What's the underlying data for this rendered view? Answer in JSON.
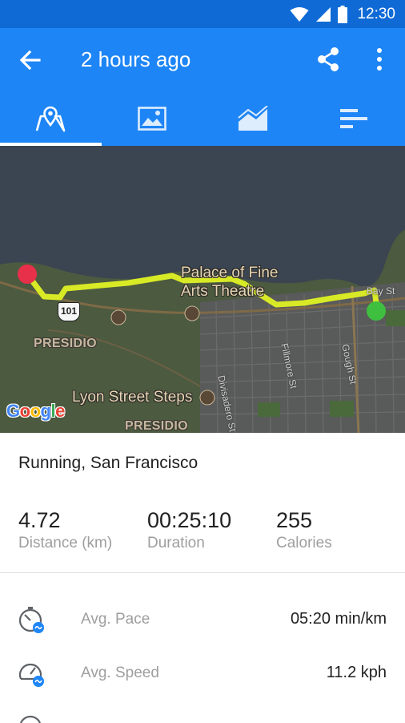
{
  "status_bar": {
    "time": "12:30"
  },
  "app_bar": {
    "title": "2 hours ago",
    "tabs": [
      {
        "id": "map",
        "icon": "map-pin-icon",
        "selected": true
      },
      {
        "id": "photos",
        "icon": "image-icon",
        "selected": false
      },
      {
        "id": "charts",
        "icon": "area-chart-icon",
        "selected": false
      },
      {
        "id": "splits",
        "icon": "bar-list-icon",
        "selected": false
      }
    ]
  },
  "map": {
    "labels": {
      "palace_line1": "Palace of Fine",
      "palace_line2": "Arts Theatre",
      "bay_st": "Bay St",
      "highway": "101",
      "presidio_1": "PRESIDIO",
      "presidio_2": "PRESIDIO",
      "lyon_steps": "Lyon Street Steps",
      "divisadero": "Divisadero St",
      "fillmore": "Fillmore St",
      "gough": "Gough St",
      "google": "Google"
    },
    "colors": {
      "water": "#3b4451",
      "land": "#4c5a40",
      "route": "#d8ea26",
      "start_marker": "#3fbf3f",
      "end_marker": "#e8304a"
    }
  },
  "activity": {
    "title": "Running, San Francisco",
    "stats": [
      {
        "value": "4.72",
        "label": "Distance (km)"
      },
      {
        "value": "00:25:10",
        "label": "Duration"
      },
      {
        "value": "255",
        "label": "Calories"
      }
    ],
    "metrics": [
      {
        "icon": "pace-stopwatch-icon",
        "label": "Avg. Pace",
        "value": "05:20 min/km"
      },
      {
        "icon": "speedometer-icon",
        "label": "Avg. Speed",
        "value": "11.2 kph"
      }
    ]
  },
  "accent_color": "#1e85f6"
}
